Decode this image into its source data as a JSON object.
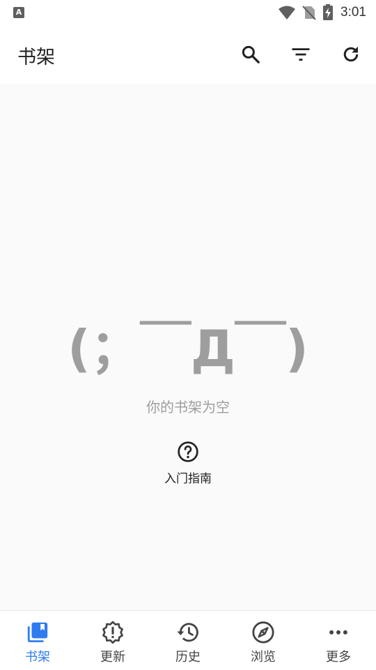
{
  "status_bar": {
    "left_icon_letter": "A",
    "time": "3:01",
    "icons": [
      "wifi-icon",
      "no-sim-icon",
      "battery-charging-icon"
    ]
  },
  "app_bar": {
    "title": "书架",
    "actions": [
      {
        "name": "search-icon"
      },
      {
        "name": "filter-icon"
      },
      {
        "name": "refresh-icon"
      }
    ]
  },
  "empty_state": {
    "face": "(；￣Д￣)",
    "message": "你的书架为空",
    "guide_icon": "help-circle-icon",
    "guide_label": "入门指南"
  },
  "bottom_nav": {
    "active_index": 0,
    "active_color": "#2f7cf0",
    "items": [
      {
        "label": "书架",
        "icon": "library-icon"
      },
      {
        "label": "更新",
        "icon": "alert-badge-icon"
      },
      {
        "label": "历史",
        "icon": "history-icon"
      },
      {
        "label": "浏览",
        "icon": "compass-icon"
      },
      {
        "label": "更多",
        "icon": "more-dots-icon"
      }
    ]
  }
}
